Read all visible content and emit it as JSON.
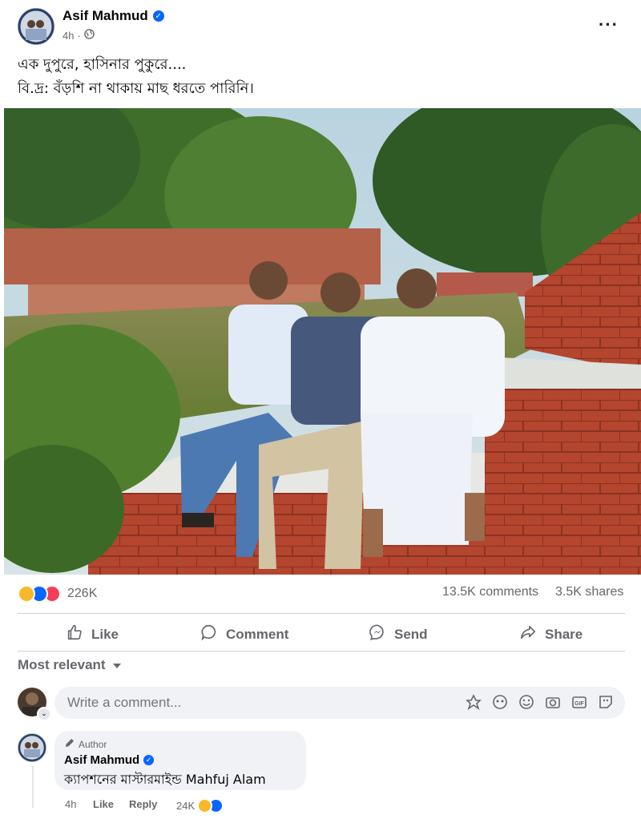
{
  "post": {
    "author": "Asif Mahmud",
    "time": "4h",
    "caption_line1": "এক দুপুরে, হাসিনার পুকুরে....",
    "caption_line2": "বি.দ্র: বঁড়শি না থাকায় মাছ ধরতে পারিনি।"
  },
  "stats": {
    "reactions_count": "226K",
    "comments": "13.5K comments",
    "shares": "3.5K shares"
  },
  "actions": {
    "like": "Like",
    "comment": "Comment",
    "send": "Send",
    "share": "Share"
  },
  "comments_section": {
    "sort_label": "Most relevant",
    "write_placeholder": "Write a comment...",
    "top_comment": {
      "badge": "Author",
      "name": "Asif Mahmud",
      "text": "ক্যাপশনের মাস্টারমাইন্ড Mahfuj Alam",
      "time": "4h",
      "like": "Like",
      "reply": "Reply",
      "reaction_count": "24K"
    }
  },
  "colors": {
    "brand_blue": "#0866ff",
    "secondary_text": "#65676b",
    "comment_bg": "#f0f2f5"
  }
}
